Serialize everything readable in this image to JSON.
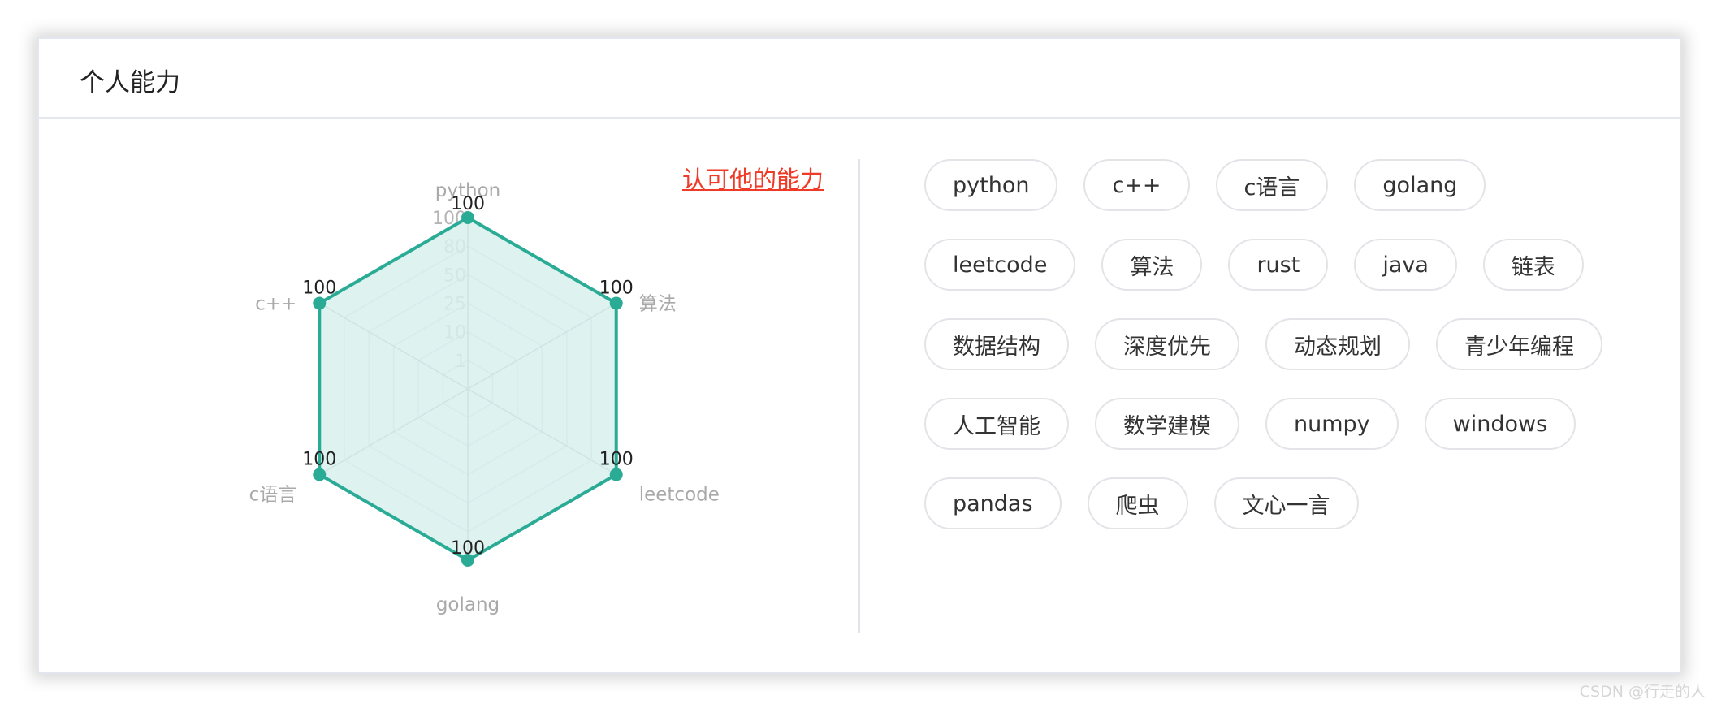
{
  "card": {
    "title": "个人能力",
    "endorse_link": "认可他的能力"
  },
  "chart_data": {
    "type": "radar",
    "indicators": [
      "python",
      "算法",
      "leetcode",
      "golang",
      "c语言",
      "c++"
    ],
    "values": [
      100,
      100,
      100,
      100,
      100,
      100
    ],
    "scale_labels": [
      "1",
      "10",
      "25",
      "50",
      "80",
      "100"
    ],
    "max": 100,
    "colors": {
      "line": "#2aab95",
      "fill": "#d8f0ec",
      "grid": "#c8d6e0",
      "axis": "#9aa1a6",
      "indicator_label": "#a9a9a9",
      "value_label": "#222222"
    }
  },
  "skills": [
    "python",
    "c++",
    "c语言",
    "golang",
    "leetcode",
    "算法",
    "rust",
    "java",
    "链表",
    "数据结构",
    "深度优先",
    "动态规划",
    "青少年编程",
    "人工智能",
    "数学建模",
    "numpy",
    "windows",
    "pandas",
    "爬虫",
    "文心一言"
  ],
  "watermark": "CSDN @行走的人"
}
